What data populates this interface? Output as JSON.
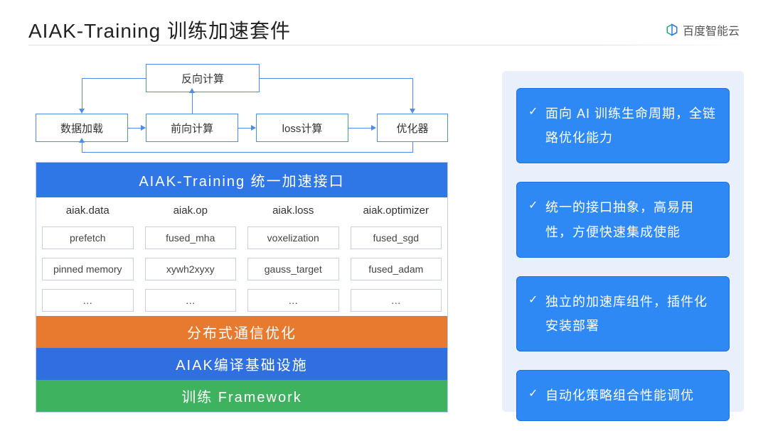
{
  "header": {
    "title": "AIAK-Training 训练加速套件",
    "logo_text": "百度智能云"
  },
  "flow": {
    "back": "反向计算",
    "data": "数据加载",
    "fwd": "前向计算",
    "loss": "loss计算",
    "opt": "优化器"
  },
  "stack": {
    "header": "AIAK-Training 统一加速接口",
    "columns": [
      "aiak.data",
      "aiak.op",
      "aiak.loss",
      "aiak.optimizer"
    ],
    "rows": [
      [
        "prefetch",
        "fused_mha",
        "voxelization",
        "fused_sgd"
      ],
      [
        "pinned memory",
        "xywh2xyxy",
        "gauss_target",
        "fused_adam"
      ],
      [
        "…",
        "…",
        "…",
        "…"
      ]
    ],
    "bars": {
      "orange": "分布式通信优化",
      "blue": "AIAK编译基础设施",
      "green": "训练 Framework"
    }
  },
  "bullets": [
    "面向 AI 训练生命周期，全链路优化能力",
    "统一的接口抽象，高易用性，方便快速集成使能",
    "独立的加速库组件，插件化安装部署",
    "自动化策略组合性能调优"
  ]
}
